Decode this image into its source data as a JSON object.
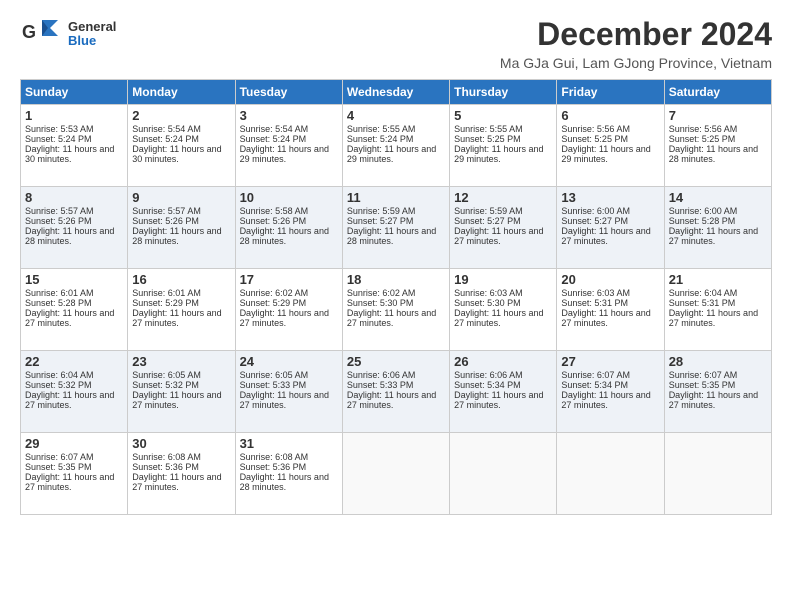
{
  "logo": {
    "general": "General",
    "blue": "Blue"
  },
  "header": {
    "title": "December 2024",
    "subtitle": "Ma GJa Gui, Lam GJong Province, Vietnam"
  },
  "weekdays": [
    "Sunday",
    "Monday",
    "Tuesday",
    "Wednesday",
    "Thursday",
    "Friday",
    "Saturday"
  ],
  "weeks": [
    [
      {
        "day": "1",
        "sunrise": "Sunrise: 5:53 AM",
        "sunset": "Sunset: 5:24 PM",
        "daylight": "Daylight: 11 hours and 30 minutes."
      },
      {
        "day": "2",
        "sunrise": "Sunrise: 5:54 AM",
        "sunset": "Sunset: 5:24 PM",
        "daylight": "Daylight: 11 hours and 30 minutes."
      },
      {
        "day": "3",
        "sunrise": "Sunrise: 5:54 AM",
        "sunset": "Sunset: 5:24 PM",
        "daylight": "Daylight: 11 hours and 29 minutes."
      },
      {
        "day": "4",
        "sunrise": "Sunrise: 5:55 AM",
        "sunset": "Sunset: 5:24 PM",
        "daylight": "Daylight: 11 hours and 29 minutes."
      },
      {
        "day": "5",
        "sunrise": "Sunrise: 5:55 AM",
        "sunset": "Sunset: 5:25 PM",
        "daylight": "Daylight: 11 hours and 29 minutes."
      },
      {
        "day": "6",
        "sunrise": "Sunrise: 5:56 AM",
        "sunset": "Sunset: 5:25 PM",
        "daylight": "Daylight: 11 hours and 29 minutes."
      },
      {
        "day": "7",
        "sunrise": "Sunrise: 5:56 AM",
        "sunset": "Sunset: 5:25 PM",
        "daylight": "Daylight: 11 hours and 28 minutes."
      }
    ],
    [
      {
        "day": "8",
        "sunrise": "Sunrise: 5:57 AM",
        "sunset": "Sunset: 5:26 PM",
        "daylight": "Daylight: 11 hours and 28 minutes."
      },
      {
        "day": "9",
        "sunrise": "Sunrise: 5:57 AM",
        "sunset": "Sunset: 5:26 PM",
        "daylight": "Daylight: 11 hours and 28 minutes."
      },
      {
        "day": "10",
        "sunrise": "Sunrise: 5:58 AM",
        "sunset": "Sunset: 5:26 PM",
        "daylight": "Daylight: 11 hours and 28 minutes."
      },
      {
        "day": "11",
        "sunrise": "Sunrise: 5:59 AM",
        "sunset": "Sunset: 5:27 PM",
        "daylight": "Daylight: 11 hours and 28 minutes."
      },
      {
        "day": "12",
        "sunrise": "Sunrise: 5:59 AM",
        "sunset": "Sunset: 5:27 PM",
        "daylight": "Daylight: 11 hours and 27 minutes."
      },
      {
        "day": "13",
        "sunrise": "Sunrise: 6:00 AM",
        "sunset": "Sunset: 5:27 PM",
        "daylight": "Daylight: 11 hours and 27 minutes."
      },
      {
        "day": "14",
        "sunrise": "Sunrise: 6:00 AM",
        "sunset": "Sunset: 5:28 PM",
        "daylight": "Daylight: 11 hours and 27 minutes."
      }
    ],
    [
      {
        "day": "15",
        "sunrise": "Sunrise: 6:01 AM",
        "sunset": "Sunset: 5:28 PM",
        "daylight": "Daylight: 11 hours and 27 minutes."
      },
      {
        "day": "16",
        "sunrise": "Sunrise: 6:01 AM",
        "sunset": "Sunset: 5:29 PM",
        "daylight": "Daylight: 11 hours and 27 minutes."
      },
      {
        "day": "17",
        "sunrise": "Sunrise: 6:02 AM",
        "sunset": "Sunset: 5:29 PM",
        "daylight": "Daylight: 11 hours and 27 minutes."
      },
      {
        "day": "18",
        "sunrise": "Sunrise: 6:02 AM",
        "sunset": "Sunset: 5:30 PM",
        "daylight": "Daylight: 11 hours and 27 minutes."
      },
      {
        "day": "19",
        "sunrise": "Sunrise: 6:03 AM",
        "sunset": "Sunset: 5:30 PM",
        "daylight": "Daylight: 11 hours and 27 minutes."
      },
      {
        "day": "20",
        "sunrise": "Sunrise: 6:03 AM",
        "sunset": "Sunset: 5:31 PM",
        "daylight": "Daylight: 11 hours and 27 minutes."
      },
      {
        "day": "21",
        "sunrise": "Sunrise: 6:04 AM",
        "sunset": "Sunset: 5:31 PM",
        "daylight": "Daylight: 11 hours and 27 minutes."
      }
    ],
    [
      {
        "day": "22",
        "sunrise": "Sunrise: 6:04 AM",
        "sunset": "Sunset: 5:32 PM",
        "daylight": "Daylight: 11 hours and 27 minutes."
      },
      {
        "day": "23",
        "sunrise": "Sunrise: 6:05 AM",
        "sunset": "Sunset: 5:32 PM",
        "daylight": "Daylight: 11 hours and 27 minutes."
      },
      {
        "day": "24",
        "sunrise": "Sunrise: 6:05 AM",
        "sunset": "Sunset: 5:33 PM",
        "daylight": "Daylight: 11 hours and 27 minutes."
      },
      {
        "day": "25",
        "sunrise": "Sunrise: 6:06 AM",
        "sunset": "Sunset: 5:33 PM",
        "daylight": "Daylight: 11 hours and 27 minutes."
      },
      {
        "day": "26",
        "sunrise": "Sunrise: 6:06 AM",
        "sunset": "Sunset: 5:34 PM",
        "daylight": "Daylight: 11 hours and 27 minutes."
      },
      {
        "day": "27",
        "sunrise": "Sunrise: 6:07 AM",
        "sunset": "Sunset: 5:34 PM",
        "daylight": "Daylight: 11 hours and 27 minutes."
      },
      {
        "day": "28",
        "sunrise": "Sunrise: 6:07 AM",
        "sunset": "Sunset: 5:35 PM",
        "daylight": "Daylight: 11 hours and 27 minutes."
      }
    ],
    [
      {
        "day": "29",
        "sunrise": "Sunrise: 6:07 AM",
        "sunset": "Sunset: 5:35 PM",
        "daylight": "Daylight: 11 hours and 27 minutes."
      },
      {
        "day": "30",
        "sunrise": "Sunrise: 6:08 AM",
        "sunset": "Sunset: 5:36 PM",
        "daylight": "Daylight: 11 hours and 27 minutes."
      },
      {
        "day": "31",
        "sunrise": "Sunrise: 6:08 AM",
        "sunset": "Sunset: 5:36 PM",
        "daylight": "Daylight: 11 hours and 28 minutes."
      },
      null,
      null,
      null,
      null
    ]
  ]
}
